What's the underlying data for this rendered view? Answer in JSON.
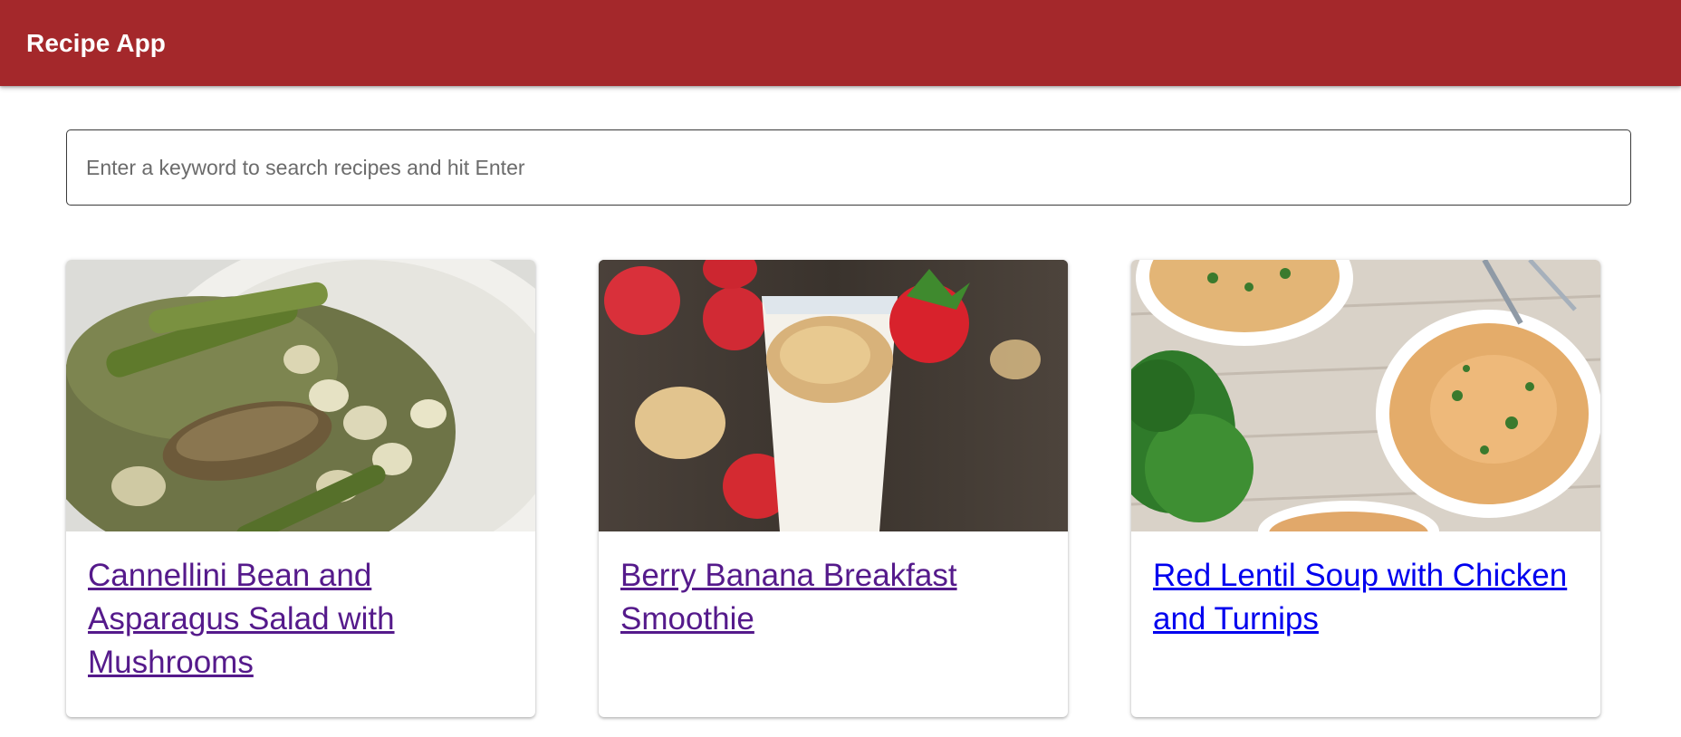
{
  "app": {
    "title": "Recipe App",
    "brand_color": "#a4282b"
  },
  "search": {
    "placeholder": "Enter a keyword to search recipes and hit Enter",
    "value": ""
  },
  "recipes": [
    {
      "title": "Cannellini Bean and Asparagus Salad with Mushrooms",
      "link_state": "visited",
      "link_color": "#551a8b",
      "image": "bean-asparagus-mushroom-salad"
    },
    {
      "title": "Berry Banana Breakfast Smoothie",
      "link_state": "visited",
      "link_color": "#551a8b",
      "image": "strawberry-smoothie-glass"
    },
    {
      "title": "Red Lentil Soup with Chicken and Turnips",
      "link_state": "unvisited",
      "link_color": "#0000ee",
      "image": "lentil-soup-bowls"
    }
  ]
}
